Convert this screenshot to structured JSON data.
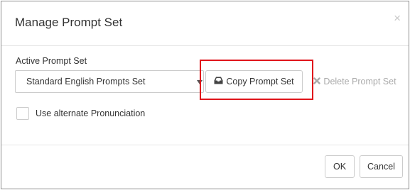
{
  "dialog": {
    "title": "Manage Prompt Set",
    "close_glyph": "×"
  },
  "active_prompt_set": {
    "label": "Active Prompt Set",
    "selected_value": "Standard English Prompts Set"
  },
  "actions": {
    "copy_label": "Copy Prompt Set",
    "copy_icon": "inbox-icon",
    "delete_label": "Delete Prompt Set",
    "delete_icon": "times-icon",
    "delete_enabled": false
  },
  "options": {
    "alternate_pronunciation_label": "Use alternate Pronunciation",
    "alternate_pronunciation_checked": false
  },
  "footer": {
    "ok_label": "OK",
    "cancel_label": "Cancel"
  },
  "colors": {
    "highlight": "#e0151b",
    "disabled_text": "#aaaaaa",
    "border": "#cccccc"
  }
}
